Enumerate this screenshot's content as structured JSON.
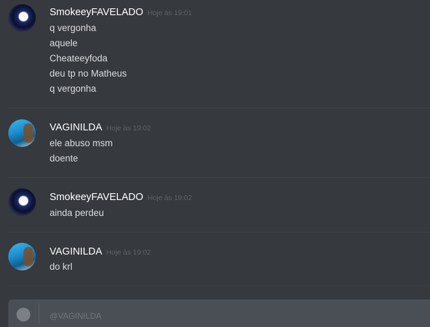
{
  "messages": [
    {
      "username": "SmokeeyFAVELADO",
      "timestamp": "Hoje às 19:01",
      "lines": [
        "q vergonha",
        "aquele",
        "Cheateeyfoda",
        "deu tp no Matheus",
        "q vergonha"
      ]
    },
    {
      "username": "VAGINILDA",
      "timestamp": "Hoje às 19:02",
      "lines": [
        "ele abuso msm",
        "doente"
      ]
    },
    {
      "username": "SmokeeyFAVELADO",
      "timestamp": "Hoje às 19:02",
      "lines": [
        "ainda perdeu"
      ]
    },
    {
      "username": "VAGINILDA",
      "timestamp": "Hoje às 19:02",
      "lines": [
        "do krl"
      ]
    }
  ],
  "composer": {
    "placeholder": "@VAGINILDA"
  }
}
